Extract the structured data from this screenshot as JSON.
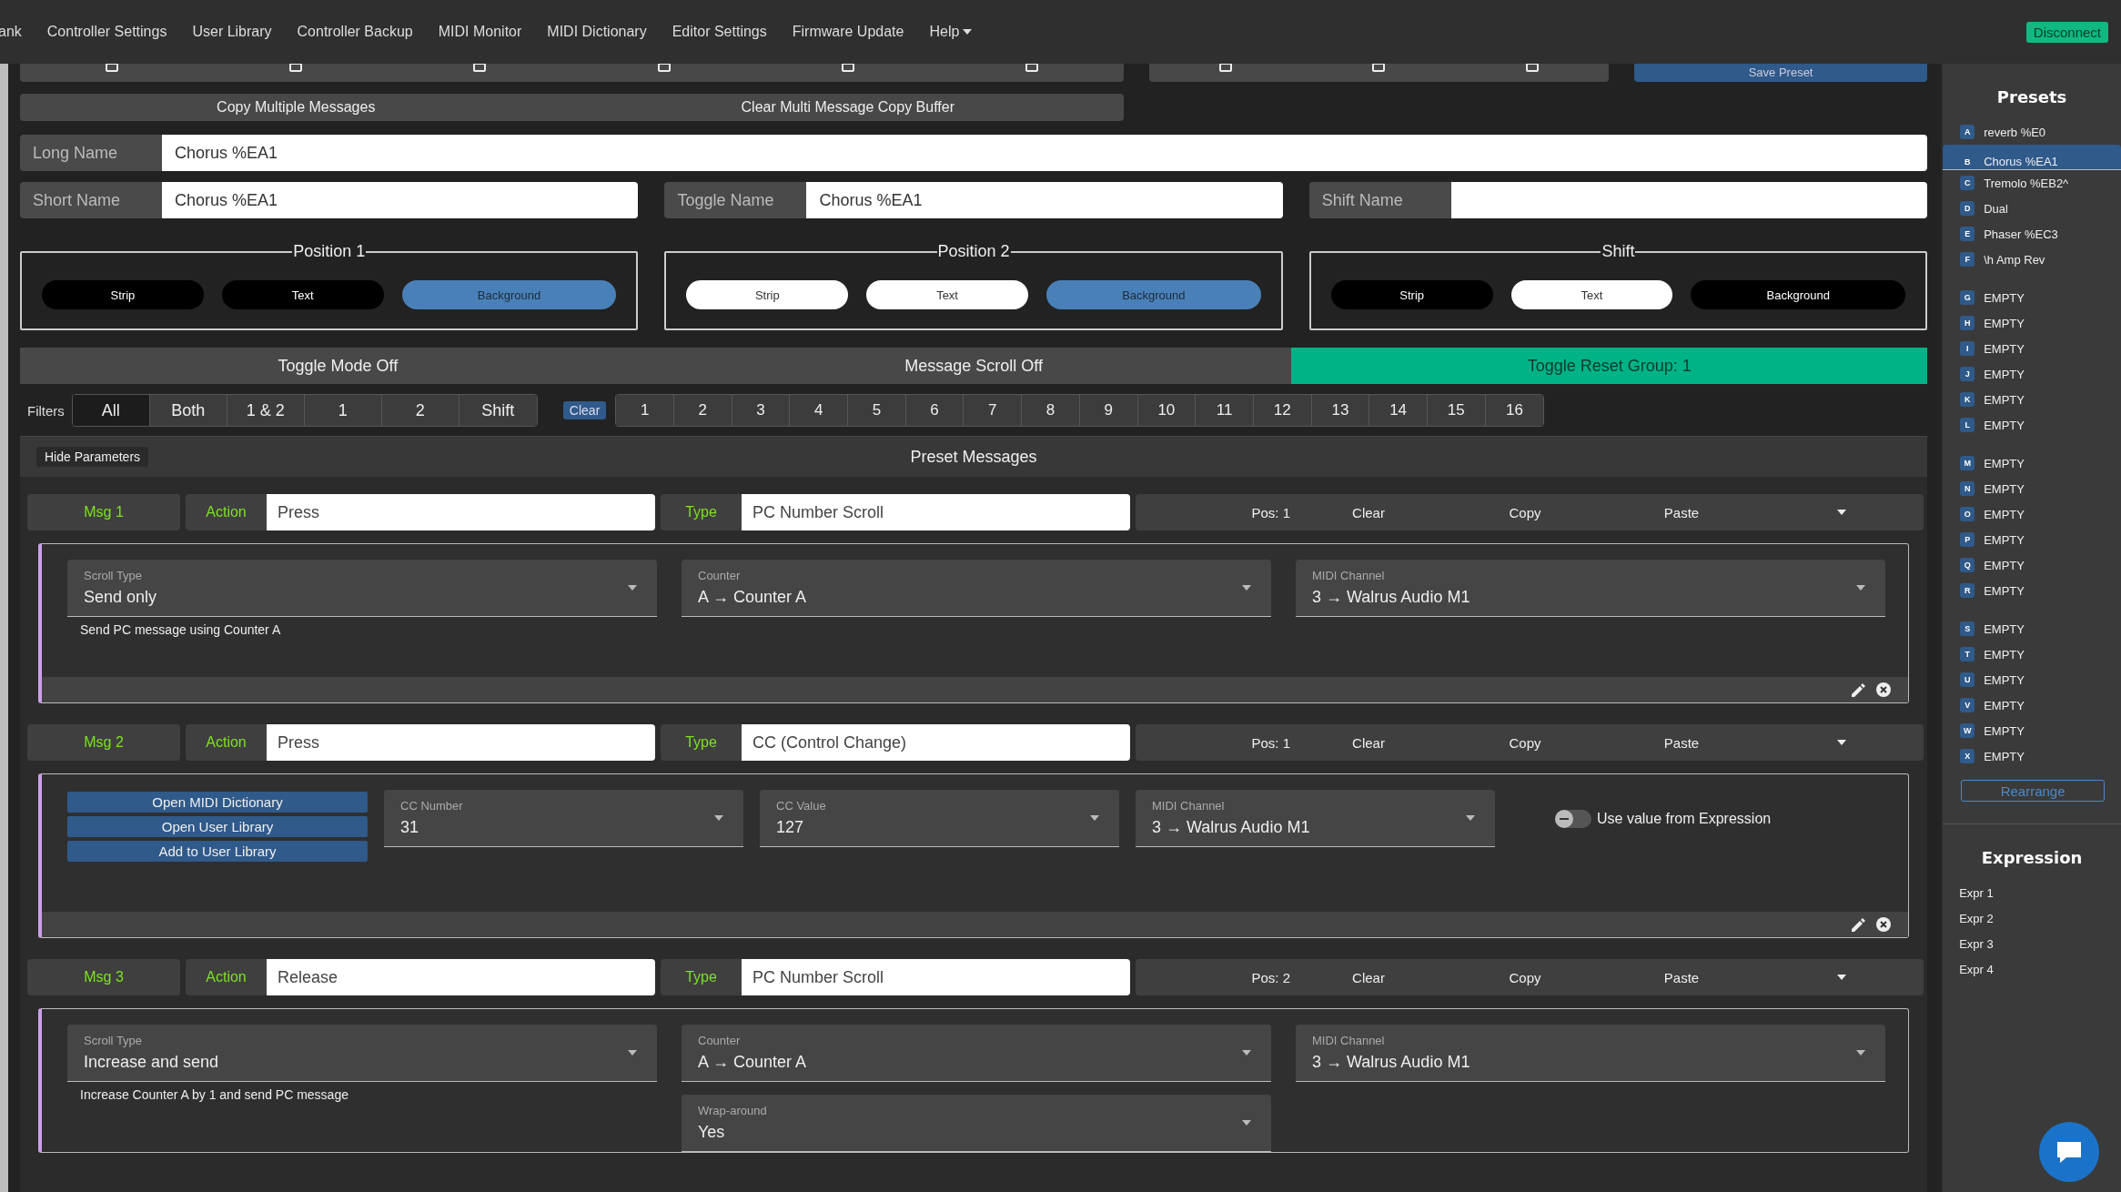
{
  "nav": {
    "items": [
      {
        "label": "ank",
        "dropdown": false
      },
      {
        "label": "Controller Settings",
        "dropdown": false
      },
      {
        "label": "User Library",
        "dropdown": false
      },
      {
        "label": "Controller Backup",
        "dropdown": false
      },
      {
        "label": "MIDI Monitor",
        "dropdown": false
      },
      {
        "label": "MIDI Dictionary",
        "dropdown": false
      },
      {
        "label": "Editor Settings",
        "dropdown": false
      },
      {
        "label": "Firmware Update",
        "dropdown": false
      },
      {
        "label": "Help",
        "dropdown": true
      }
    ],
    "disconnect": "Disconnect"
  },
  "toolbar": {
    "save_button": "Save Preset"
  },
  "copy_buttons": [
    "Copy Multiple Messages",
    "Clear Multi Message Copy Buffer"
  ],
  "long_name": {
    "label": "Long Name",
    "value": "Chorus %EA1"
  },
  "names": [
    {
      "label": "Short Name",
      "value": "Chorus %EA1"
    },
    {
      "label": "Toggle Name",
      "value": "Chorus %EA1"
    },
    {
      "label": "Shift Name"
    }
  ],
  "positions": [
    {
      "title": "Position 1",
      "buttons": [
        {
          "label": "Strip",
          "color": "#000000"
        },
        {
          "label": "Text",
          "color": "#000000"
        },
        {
          "label": "Background",
          "color": "#4a80b8"
        }
      ]
    },
    {
      "title": "Position 2",
      "buttons": [
        {
          "label": "Strip",
          "color": "#ffffff"
        },
        {
          "label": "Text",
          "color": "#ffffff"
        },
        {
          "label": "Background",
          "color": "#4a80b8"
        }
      ]
    },
    {
      "title": "Shift",
      "buttons": [
        {
          "label": "Strip",
          "color": "#000000"
        },
        {
          "label": "Text",
          "color": "#ffffff"
        },
        {
          "label": "Background",
          "color": "#000000"
        }
      ]
    }
  ],
  "modes": [
    {
      "label": "Toggle Mode Off",
      "on": false
    },
    {
      "label": "Message Scroll Off",
      "on": false
    },
    {
      "label": "Toggle Reset Group: 1",
      "on": true
    }
  ],
  "filters": {
    "label": "Filters",
    "options": [
      {
        "label": "All",
        "selected": true
      },
      {
        "label": "Both",
        "selected": false
      },
      {
        "label": "1 & 2",
        "selected": false
      },
      {
        "label": "1",
        "selected": false
      },
      {
        "label": "2",
        "selected": false
      },
      {
        "label": "Shift",
        "selected": false
      }
    ],
    "clear": "Clear",
    "numbers": [
      {
        "label": "1",
        "selected": false
      },
      {
        "label": "2",
        "selected": false
      },
      {
        "label": "3",
        "selected": false
      },
      {
        "label": "4",
        "selected": false
      },
      {
        "label": "5",
        "selected": false
      },
      {
        "label": "6",
        "selected": false
      },
      {
        "label": "7",
        "selected": false
      },
      {
        "label": "8",
        "selected": false
      },
      {
        "label": "9",
        "selected": false
      },
      {
        "label": "10",
        "selected": false
      },
      {
        "label": "11",
        "selected": false
      },
      {
        "label": "12",
        "selected": false
      },
      {
        "label": "13",
        "selected": false
      },
      {
        "label": "14",
        "selected": false
      },
      {
        "label": "15",
        "selected": false
      },
      {
        "label": "16",
        "selected": false
      }
    ]
  },
  "messages_panel": {
    "hide_button": "Hide Parameters",
    "title": "Preset Messages",
    "messages": [
      {
        "label": "Msg 1",
        "action_label": "Action",
        "action": "Press",
        "type_label": "Type",
        "type": "PC Number Scroll",
        "pos": "Pos: 1",
        "tools": [
          "Clear",
          "Copy",
          "Paste"
        ],
        "kind": "grid",
        "footer": true,
        "items": [
          {
            "kind": "select",
            "label": "Scroll Type",
            "value": "Send only"
          },
          {
            "kind": "select",
            "label": "Counter",
            "value": "A → Counter A"
          },
          {
            "kind": "select",
            "label": "MIDI Channel",
            "value": "3 → Walrus Audio M1"
          },
          {
            "kind": "note",
            "text": "Send PC message using Counter A"
          }
        ]
      },
      {
        "label": "Msg 2",
        "action_label": "Action",
        "action": "Press",
        "type_label": "Type",
        "type": "CC (Control Change)",
        "pos": "Pos: 1",
        "tools": [
          "Clear",
          "Copy",
          "Paste"
        ],
        "kind": "row",
        "footer": true,
        "items": [
          {
            "kind": "buttons",
            "buttons": [
              "Open MIDI Dictionary",
              "Open User Library",
              "Add to User Library"
            ]
          },
          {
            "kind": "select",
            "label": "CC Number",
            "value": "31"
          },
          {
            "kind": "select",
            "label": "CC Value",
            "value": "127"
          },
          {
            "kind": "select",
            "label": "MIDI Channel",
            "value": "3 → Walrus Audio M1"
          },
          {
            "kind": "toggle",
            "label": "Use value from Expression",
            "on": false
          }
        ]
      },
      {
        "label": "Msg 3",
        "action_label": "Action",
        "action": "Release",
        "type_label": "Type",
        "type": "PC Number Scroll",
        "pos": "Pos: 2",
        "tools": [
          "Clear",
          "Copy",
          "Paste"
        ],
        "kind": "grid",
        "footer": false,
        "items": [
          {
            "kind": "select",
            "label": "Scroll Type",
            "value": "Increase and send"
          },
          {
            "kind": "select",
            "label": "Counter",
            "value": "A → Counter A"
          },
          {
            "kind": "select",
            "label": "MIDI Channel",
            "value": "3 → Walrus Audio M1"
          },
          {
            "kind": "note",
            "text": "Increase Counter A by 1 and send PC message"
          },
          {
            "kind": "select",
            "label": "Wrap-around",
            "value": "Yes"
          }
        ]
      }
    ]
  },
  "sidebar": {
    "title": "Presets",
    "groups": [
      [
        {
          "letter": "A",
          "name": "reverb %E0",
          "selected": false
        },
        {
          "letter": "B",
          "name": "Chorus %EA1",
          "selected": true
        },
        {
          "letter": "C",
          "name": "Tremolo %EB2^",
          "selected": false
        },
        {
          "letter": "D",
          "name": "Dual",
          "selected": false
        },
        {
          "letter": "E",
          "name": "Phaser %EC3",
          "selected": false
        },
        {
          "letter": "F",
          "name": "\\h Amp Rev",
          "selected": false
        }
      ],
      [
        {
          "letter": "G",
          "name": "EMPTY",
          "selected": false
        },
        {
          "letter": "H",
          "name": "EMPTY",
          "selected": false
        },
        {
          "letter": "I",
          "name": "EMPTY",
          "selected": false
        },
        {
          "letter": "J",
          "name": "EMPTY",
          "selected": false
        },
        {
          "letter": "K",
          "name": "EMPTY",
          "selected": false
        },
        {
          "letter": "L",
          "name": "EMPTY",
          "selected": false
        }
      ],
      [
        {
          "letter": "M",
          "name": "EMPTY",
          "selected": false
        },
        {
          "letter": "N",
          "name": "EMPTY",
          "selected": false
        },
        {
          "letter": "O",
          "name": "EMPTY",
          "selected": false
        },
        {
          "letter": "P",
          "name": "EMPTY",
          "selected": false
        },
        {
          "letter": "Q",
          "name": "EMPTY",
          "selected": false
        },
        {
          "letter": "R",
          "name": "EMPTY",
          "selected": false
        }
      ],
      [
        {
          "letter": "S",
          "name": "EMPTY",
          "selected": false
        },
        {
          "letter": "T",
          "name": "EMPTY",
          "selected": false
        },
        {
          "letter": "U",
          "name": "EMPTY",
          "selected": false
        },
        {
          "letter": "V",
          "name": "EMPTY",
          "selected": false
        },
        {
          "letter": "W",
          "name": "EMPTY",
          "selected": false
        },
        {
          "letter": "X",
          "name": "EMPTY",
          "selected": false
        }
      ]
    ],
    "rearrange": "Rearrange",
    "expression_title": "Expression",
    "expressions": [
      "Expr 1",
      "Expr 2",
      "Expr 3",
      "Expr 4"
    ]
  }
}
